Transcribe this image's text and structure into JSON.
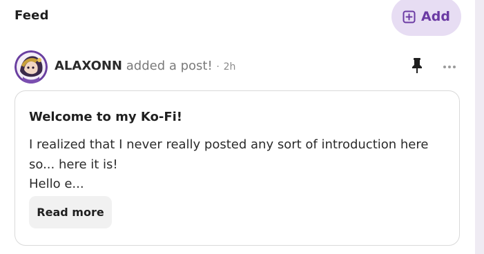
{
  "feed": {
    "title": "Feed",
    "add_label": "Add",
    "add_icon": "plus-square-icon"
  },
  "post": {
    "author": "ALAXONN",
    "action": "added a post!",
    "separator": "·",
    "time": "2h",
    "title": "Welcome to my Ko-Fi!",
    "excerpt_lines": [
      "I realized that I never really posted any sort of introduction here",
      "so... here it is!",
      "Hello e..."
    ],
    "read_more_label": "Read more",
    "pin_icon": "pin-icon",
    "more_icon": "more-icon"
  },
  "colors": {
    "accent": "#6b3aa3",
    "accent_bg": "#e7ddf3",
    "rail": "#efebf3",
    "card_border": "#d9d9d9",
    "button_bg": "#f1f1f1"
  }
}
